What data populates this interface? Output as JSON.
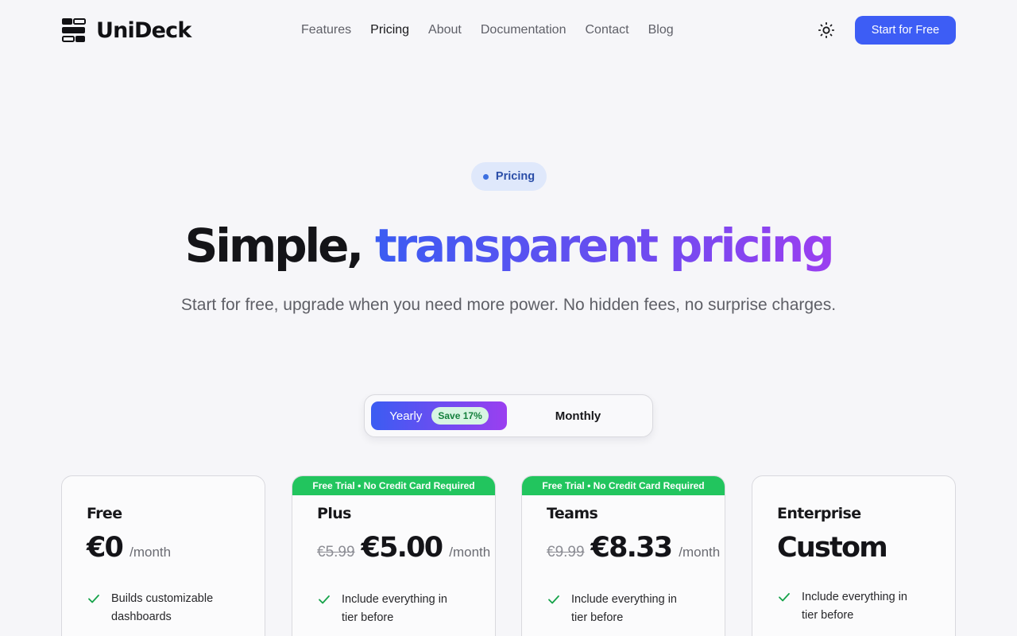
{
  "brand": {
    "name": "UniDeck"
  },
  "nav": {
    "items": [
      {
        "label": "Features",
        "active": false
      },
      {
        "label": "Pricing",
        "active": true
      },
      {
        "label": "About",
        "active": false
      },
      {
        "label": "Documentation",
        "active": false
      },
      {
        "label": "Contact",
        "active": false
      },
      {
        "label": "Blog",
        "active": false
      }
    ],
    "theme_icon": "sun-icon",
    "cta_label": "Start for Free"
  },
  "hero": {
    "badge": "Pricing",
    "title_plain": "Simple,",
    "title_grad": "transparent pricing",
    "subtitle": "Start for free, upgrade when you need more power. No hidden fees, no surprise charges."
  },
  "billing": {
    "yearly_label": "Yearly",
    "save_badge": "Save 17%",
    "monthly_label": "Monthly",
    "selected": "Yearly"
  },
  "colors": {
    "accent": "#3d5df5",
    "gradient_start": "#3b5cf2",
    "gradient_end": "#9b3ff0",
    "trial_green": "#22c55e",
    "check_green": "#16a34a"
  },
  "plans": [
    {
      "name": "Free",
      "trial": "",
      "old_price": "",
      "price": "€0",
      "period": "/month",
      "feature": "Builds customizable dashboards"
    },
    {
      "name": "Plus",
      "trial": "Free Trial • No Credit Card Required",
      "old_price": "€5.99",
      "price": "€5.00",
      "period": "/month",
      "feature": "Include everything in tier before"
    },
    {
      "name": "Teams",
      "trial": "Free Trial • No Credit Card Required",
      "old_price": "€9.99",
      "price": "€8.33",
      "period": "/month",
      "feature": "Include everything in tier before"
    },
    {
      "name": "Enterprise",
      "trial": "",
      "old_price": "",
      "price": "Custom",
      "period": "",
      "feature": "Include everything in tier before"
    }
  ]
}
